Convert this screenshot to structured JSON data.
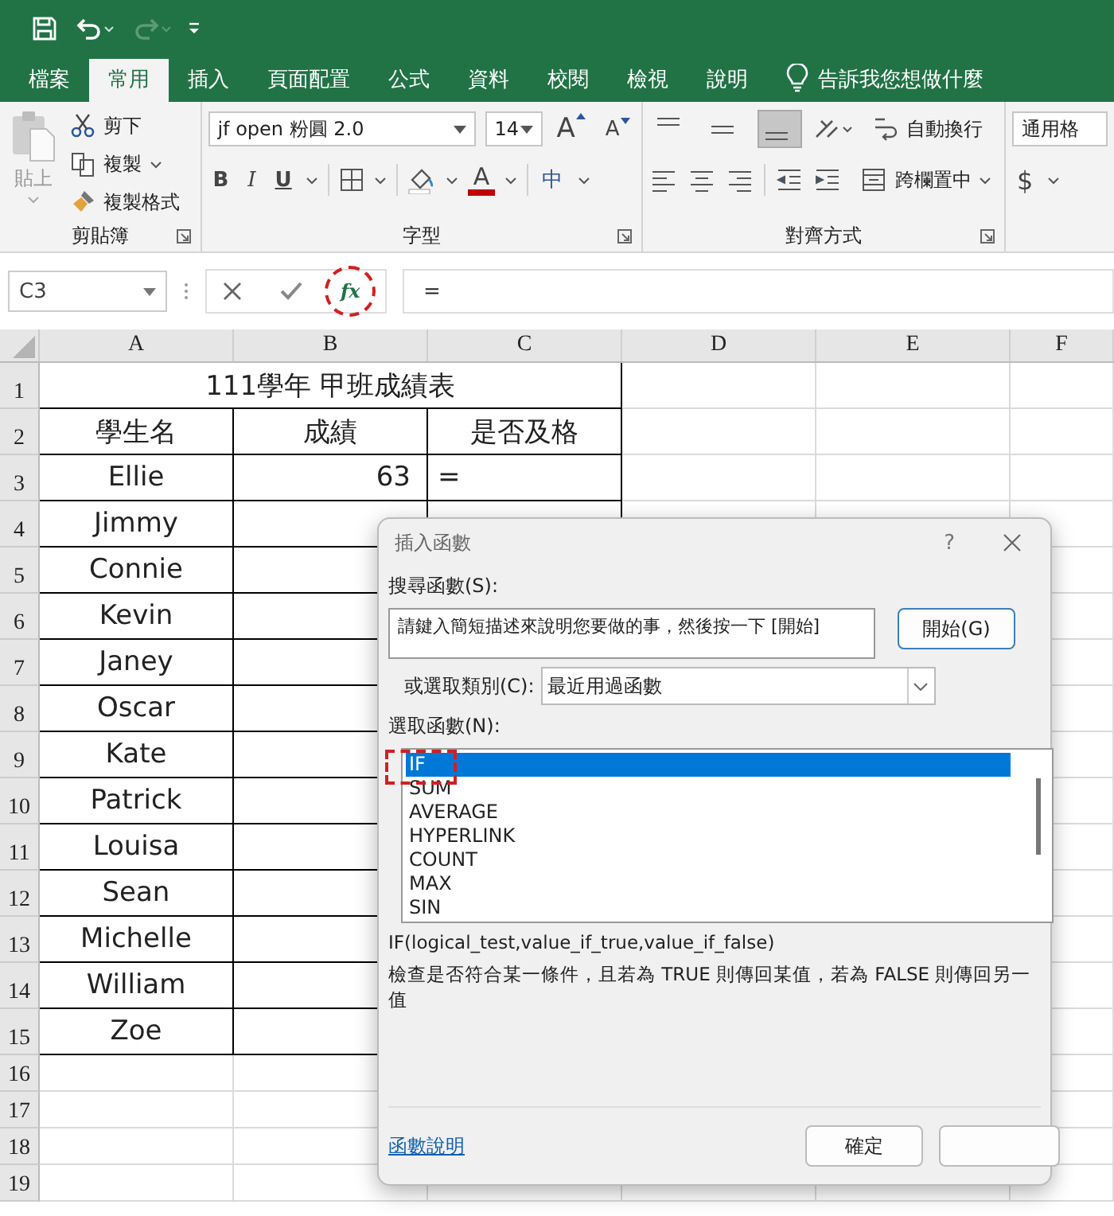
{
  "tabs": [
    {
      "label": "檔案",
      "selected": false
    },
    {
      "label": "常用",
      "selected": true
    },
    {
      "label": "插入",
      "selected": false
    },
    {
      "label": "頁面配置",
      "selected": false
    },
    {
      "label": "公式",
      "selected": false
    },
    {
      "label": "資料",
      "selected": false
    },
    {
      "label": "校閱",
      "selected": false
    },
    {
      "label": "檢視",
      "selected": false
    },
    {
      "label": "說明",
      "selected": false
    }
  ],
  "tell_me": "告訴我您想做什麼",
  "ribbon": {
    "clipboard": {
      "paste": "貼上",
      "cut": "剪下",
      "copy": "複製",
      "format_painter": "複製格式",
      "group_label": "剪貼簿"
    },
    "font": {
      "font_name": "jf open 粉圓 2.0",
      "font_size": "14",
      "grow_glyph": "A",
      "shrink_glyph": "A",
      "bold": "B",
      "italic": "I",
      "underline": "U",
      "font_color_glyph": "A",
      "phonetic_glyph": "中",
      "group_label": "字型"
    },
    "alignment": {
      "vertical": [
        {
          "kind": "top",
          "selected": false
        },
        {
          "kind": "middle",
          "selected": false
        },
        {
          "kind": "bottom",
          "selected": true
        }
      ],
      "wrap_text": "自動換行",
      "merge_center": "跨欄置中",
      "group_label": "對齊方式"
    },
    "number": {
      "format": "通用格",
      "currency_glyph": "$"
    }
  },
  "name_box": "C3",
  "function_glyph": "fx",
  "formula": "=",
  "columns": [
    "A",
    "B",
    "C",
    "D",
    "E",
    "F"
  ],
  "sheet": {
    "title": "111學年 甲班成績表",
    "headers": [
      "學生名",
      "成績",
      "是否及格"
    ],
    "rows": [
      {
        "name": "Ellie",
        "score": "63",
        "result": "="
      },
      {
        "name": "Jimmy"
      },
      {
        "name": "Connie"
      },
      {
        "name": "Kevin"
      },
      {
        "name": "Janey"
      },
      {
        "name": "Oscar"
      },
      {
        "name": "Kate"
      },
      {
        "name": "Patrick"
      },
      {
        "name": "Louisa"
      },
      {
        "name": "Sean"
      },
      {
        "name": "Michelle"
      },
      {
        "name": "William"
      },
      {
        "name": "Zoe"
      }
    ],
    "row_numbers": [
      "1",
      "2",
      "3",
      "4",
      "5",
      "6",
      "7",
      "8",
      "9",
      "10",
      "11",
      "12",
      "13",
      "14",
      "15",
      "16",
      "17",
      "18",
      "19"
    ]
  },
  "dialog": {
    "title": "插入函數",
    "help_glyph": "?",
    "search_label": "搜尋函數(S):",
    "search_value": "請鍵入簡短描述來說明您要做的事，然後按一下 [開始]",
    "go_button": "開始(G)",
    "category_label": "或選取類別(C):",
    "category": "最近用過函數",
    "list_label": "選取函數(N):",
    "functions": [
      {
        "label": "IF",
        "selected": true
      },
      {
        "label": "SUM",
        "selected": false
      },
      {
        "label": "AVERAGE",
        "selected": false
      },
      {
        "label": "HYPERLINK",
        "selected": false
      },
      {
        "label": "COUNT",
        "selected": false
      },
      {
        "label": "MAX",
        "selected": false
      },
      {
        "label": "SIN",
        "selected": false
      }
    ],
    "signature": "IF(logical_test,value_if_true,value_if_false)",
    "description": "檢查是否符合某一條件，且若為 TRUE 則傳回某值，若為 FALSE 則傳回另一值",
    "help_link": "函數說明",
    "ok_button": "確定"
  }
}
